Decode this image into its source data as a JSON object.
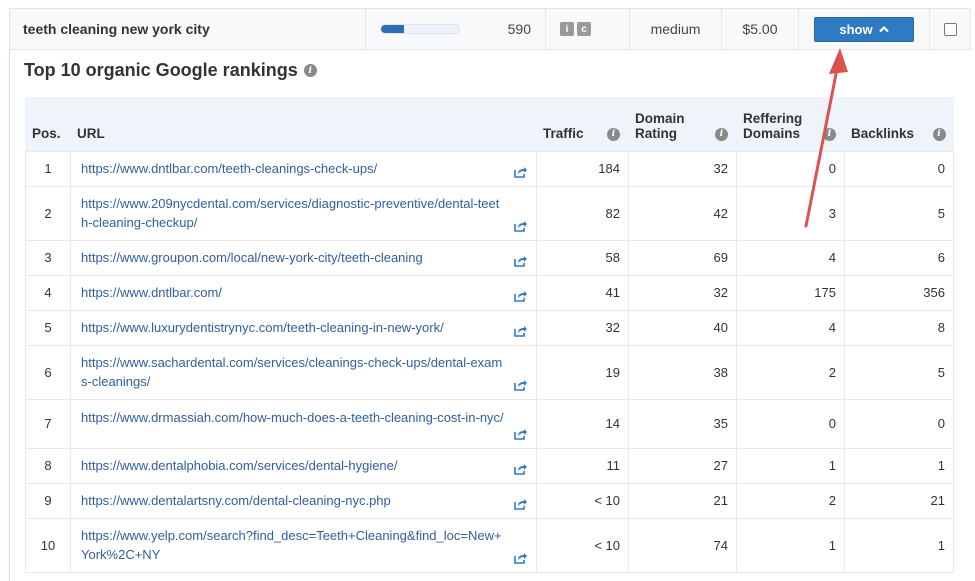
{
  "keyword_row": {
    "keyword": "teeth cleaning new york city",
    "volume": "590",
    "volume_fill_percent": 30,
    "intent_tags": [
      "i",
      "c"
    ],
    "competition": "medium",
    "cpc": "$5.00",
    "show_label": "show",
    "show_icon": "chevron-up-icon"
  },
  "panel": {
    "title": "Top 10 organic Google rankings"
  },
  "table": {
    "headers": {
      "pos": "Pos.",
      "url": "URL",
      "traffic": "Traffic",
      "dr_line1": "Domain",
      "dr_line2": "Rating",
      "rd_line1": "Reffering",
      "rd_line2": "Domains",
      "backlinks": "Backlinks"
    },
    "rows": [
      {
        "pos": "1",
        "url": "https://www.dntlbar.com/teeth-cleanings-check-ups/",
        "traffic": "184",
        "dr": "32",
        "rd": "0",
        "bl": "0"
      },
      {
        "pos": "2",
        "url": "https://www.209nycdental.com/services/diagnostic-preventive/dental-teeth-cleaning-checkup/",
        "traffic": "82",
        "dr": "42",
        "rd": "3",
        "bl": "5"
      },
      {
        "pos": "3",
        "url": "https://www.groupon.com/local/new-york-city/teeth-cleaning",
        "traffic": "58",
        "dr": "69",
        "rd": "4",
        "bl": "6"
      },
      {
        "pos": "4",
        "url": "https://www.dntlbar.com/",
        "traffic": "41",
        "dr": "32",
        "rd": "175",
        "bl": "356"
      },
      {
        "pos": "5",
        "url": "https://www.luxurydentistrynyc.com/teeth-cleaning-in-new-york/",
        "traffic": "32",
        "dr": "40",
        "rd": "4",
        "bl": "8"
      },
      {
        "pos": "6",
        "url": "https://www.sachardental.com/services/cleanings-check-ups/dental-exams-cleanings/",
        "traffic": "19",
        "dr": "38",
        "rd": "2",
        "bl": "5"
      },
      {
        "pos": "7",
        "url": "https://www.drmassiah.com/how-much-does-a-teeth-cleaning-cost-in-nyc/",
        "traffic": "14",
        "dr": "35",
        "rd": "0",
        "bl": "0"
      },
      {
        "pos": "8",
        "url": "https://www.dentalphobia.com/services/dental-hygiene/",
        "traffic": "11",
        "dr": "27",
        "rd": "1",
        "bl": "1"
      },
      {
        "pos": "9",
        "url": "https://www.dentalartsny.com/dental-cleaning-nyc.php",
        "traffic": "< 10",
        "dr": "21",
        "rd": "2",
        "bl": "21"
      },
      {
        "pos": "10",
        "url": "https://www.yelp.com/search?find_desc=Teeth+Cleaning&find_loc=New+York%2C+NY",
        "traffic": "< 10",
        "dr": "74",
        "rd": "1",
        "bl": "1"
      }
    ]
  },
  "colors": {
    "accent": "#2f7bc2",
    "link": "#2f5f9e",
    "header_bg": "#eef4fa",
    "annotation_arrow": "#d9534f"
  }
}
